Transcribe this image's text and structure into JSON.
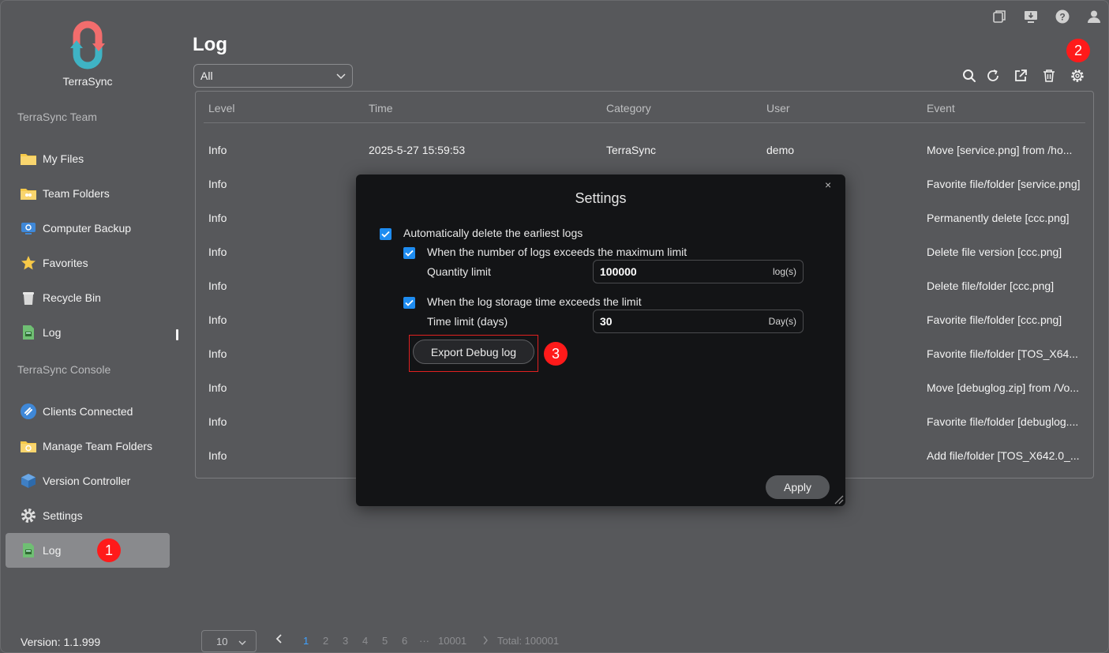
{
  "app": {
    "name": "TerraSync",
    "version": "Version: 1.1.999"
  },
  "sidebar": {
    "section_team": "TerraSync Team",
    "section_console": "TerraSync Console",
    "team_items": [
      {
        "label": "My Files",
        "icon": "folder-icon"
      },
      {
        "label": "Team Folders",
        "icon": "team-folder-icon"
      },
      {
        "label": "Computer Backup",
        "icon": "computer-backup-icon"
      },
      {
        "label": "Favorites",
        "icon": "star-icon"
      },
      {
        "label": "Recycle Bin",
        "icon": "recycle-bin-icon"
      },
      {
        "label": "Log",
        "icon": "log-icon"
      }
    ],
    "console_items": [
      {
        "label": "Clients Connected",
        "icon": "link-icon"
      },
      {
        "label": "Manage Team Folders",
        "icon": "manage-folder-icon"
      },
      {
        "label": "Version Controller",
        "icon": "cube-icon"
      },
      {
        "label": "Settings",
        "icon": "gear-icon"
      },
      {
        "label": "Log",
        "icon": "log-icon",
        "active": true
      }
    ]
  },
  "page": {
    "title": "Log",
    "filter_value": "All"
  },
  "table": {
    "headers": [
      "Level",
      "Time",
      "Category",
      "User",
      "Event"
    ],
    "rows": [
      {
        "level": "Info",
        "time": "2025-5-27 15:59:53",
        "category": "TerraSync",
        "user": "demo",
        "event": "Move [service.png] from /ho..."
      },
      {
        "level": "Info",
        "event": "Favorite file/folder [service.png]"
      },
      {
        "level": "Info",
        "event": "Permanently delete [ccc.png]"
      },
      {
        "level": "Info",
        "event": "Delete file version [ccc.png]"
      },
      {
        "level": "Info",
        "event": "Delete file/folder [ccc.png]"
      },
      {
        "level": "Info",
        "event": "Favorite file/folder [ccc.png]"
      },
      {
        "level": "Info",
        "event": "Favorite file/folder [TOS_X64..."
      },
      {
        "level": "Info",
        "event": "Move [debuglog.zip] from /Vo..."
      },
      {
        "level": "Info",
        "event": "Favorite file/folder [debuglog...."
      },
      {
        "level": "Info",
        "event": "Add file/folder [TOS_X642.0_..."
      }
    ]
  },
  "pagination": {
    "page_size": "10",
    "pages": [
      "1",
      "2",
      "3",
      "4",
      "5",
      "6"
    ],
    "ellipsis": "···",
    "last_page": "10001",
    "total": "Total: 100001",
    "current": "1"
  },
  "modal": {
    "title": "Settings",
    "close": "×",
    "auto_delete_label": "Automatically delete the earliest logs",
    "count_limit_label": "When the number of logs exceeds the maximum limit",
    "quantity_label": "Quantity limit",
    "quantity_value": "100000",
    "quantity_unit": "log(s)",
    "time_limit_check_label": "When the log storage time exceeds the limit",
    "time_label": "Time limit (days)",
    "time_value": "30",
    "time_unit": "Day(s)",
    "export_button": "Export Debug log",
    "apply_button": "Apply"
  },
  "annotations": {
    "one": "1",
    "two": "2",
    "three": "3"
  },
  "colors": {
    "accent": "#1e8cf0",
    "badge": "#ff1a1a",
    "current_page": "#3ea1ff"
  }
}
